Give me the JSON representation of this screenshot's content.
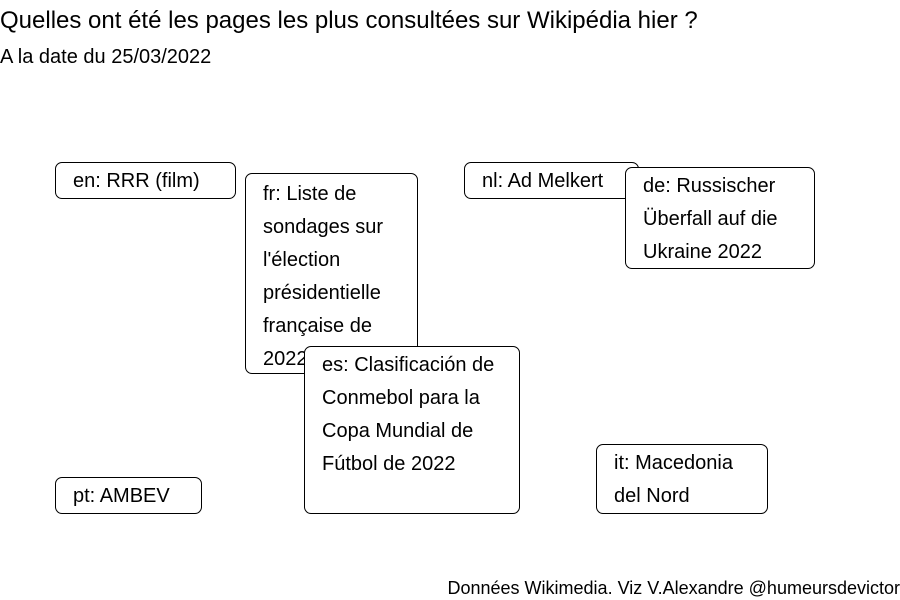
{
  "title": "Quelles ont été les pages les plus consultées sur Wikipédia hier ?",
  "subtitle": "A la date du 25/03/2022",
  "caption": "Données Wikimedia. Viz V.Alexandre @humeursdevictor",
  "chart_data": {
    "type": "label-cloud",
    "labels": [
      {
        "lang": "en",
        "text": "en: RRR (film)"
      },
      {
        "lang": "fr",
        "text": "fr: Liste de sondages sur l'élection présidentielle française de 2022"
      },
      {
        "lang": "nl",
        "text": "nl: Ad Melkert"
      },
      {
        "lang": "de",
        "text": "de: Russischer Überfall auf die Ukraine 2022"
      },
      {
        "lang": "es",
        "text": "es: Clasificación de Conmebol para la Copa Mundial de Fútbol de 2022"
      },
      {
        "lang": "pt",
        "text": "pt: AMBEV"
      },
      {
        "lang": "it",
        "text": "it: Macedonia del Nord"
      }
    ]
  }
}
